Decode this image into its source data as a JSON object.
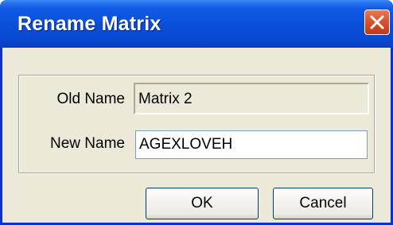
{
  "dialog": {
    "title": "Rename Matrix",
    "close_icon": "close-icon",
    "accent_color": "#0a4fd9",
    "close_color": "#d9532c"
  },
  "fields": {
    "old_name_label": "Old Name",
    "old_name_value": "Matrix 2",
    "new_name_label": "New Name",
    "new_name_value": "AGEXLOVEH"
  },
  "buttons": {
    "ok_label": "OK",
    "cancel_label": "Cancel"
  }
}
